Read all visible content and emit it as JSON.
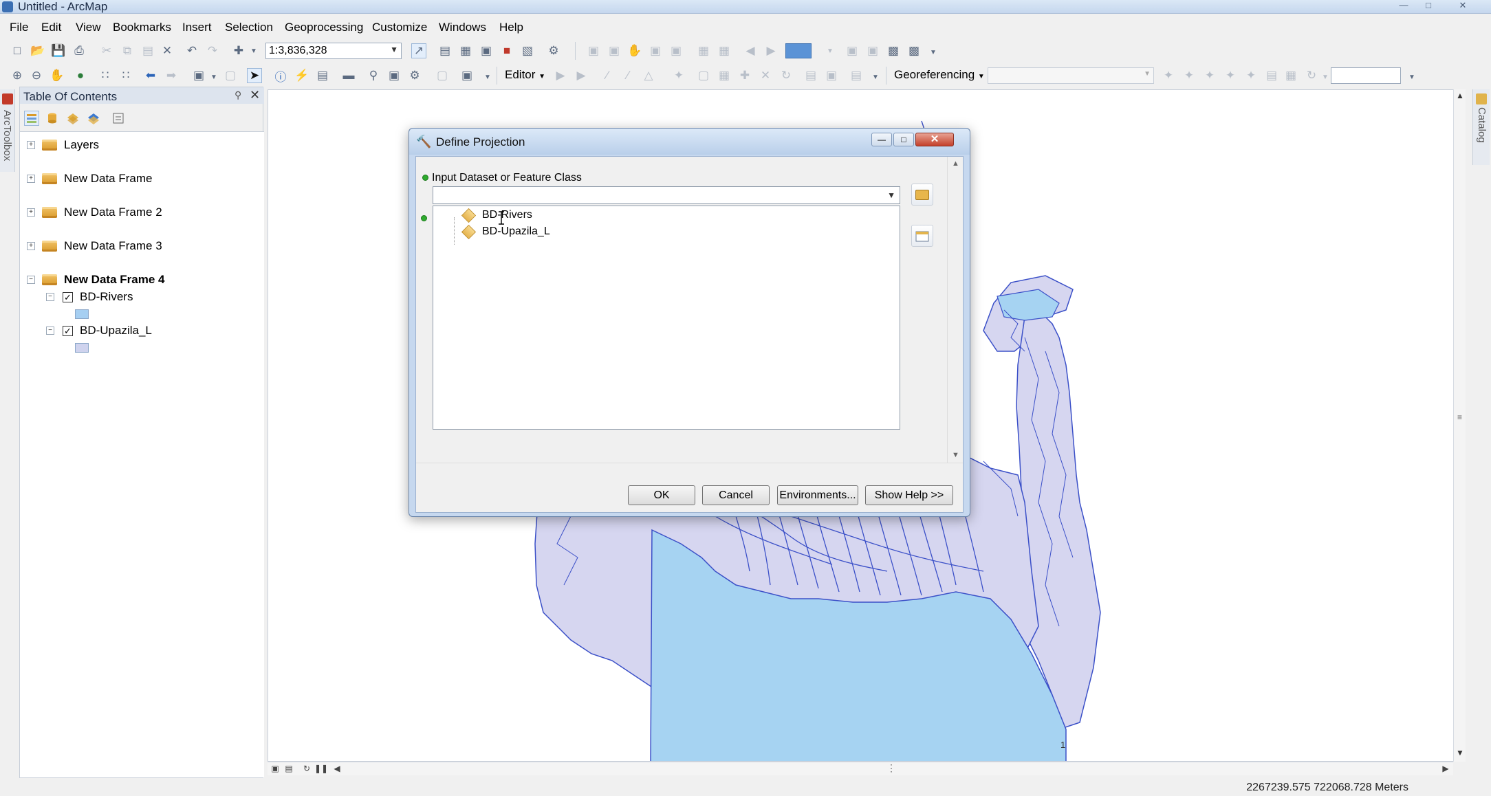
{
  "window": {
    "title": "Untitled - ArcMap"
  },
  "menu": [
    "File",
    "Edit",
    "View",
    "Bookmarks",
    "Insert",
    "Selection",
    "Geoprocessing",
    "Customize",
    "Windows",
    "Help"
  ],
  "toolbar": {
    "scale": "1:3,836,328",
    "editor_label": "Editor",
    "georeferencing_label": "Georeferencing"
  },
  "left_strip": {
    "label": "ArcToolbox"
  },
  "right_strip": {
    "label": "Catalog"
  },
  "toc": {
    "title": "Table Of Contents",
    "items": [
      {
        "label": "Layers",
        "bold": false
      },
      {
        "label": "New Data Frame",
        "bold": false
      },
      {
        "label": "New Data Frame 2",
        "bold": false
      },
      {
        "label": "New Data Frame 3",
        "bold": false
      },
      {
        "label": "New Data Frame 4",
        "bold": true
      }
    ],
    "layers": [
      {
        "label": "BD-Rivers",
        "checked": true,
        "swatch_color": "#a6cff2"
      },
      {
        "label": "BD-Upazila_L",
        "checked": true,
        "swatch_color": "#cfd3ee"
      }
    ]
  },
  "dialog": {
    "title": "Define Projection",
    "input_label": "Input Dataset or Feature Class",
    "input_value": "",
    "list_items": [
      "BD-Rivers",
      "BD-Upazila_L"
    ],
    "buttons": {
      "ok": "OK",
      "cancel": "Cancel",
      "environments": "Environments...",
      "show_help": "Show Help >>"
    }
  },
  "status": {
    "coordinates": "2267239.575  722068.728 Meters"
  },
  "map": {
    "page_marker": "1",
    "colors": {
      "water": "#a6d3f2",
      "land": "#d6d6f0",
      "outline": "#3b50c8"
    }
  }
}
